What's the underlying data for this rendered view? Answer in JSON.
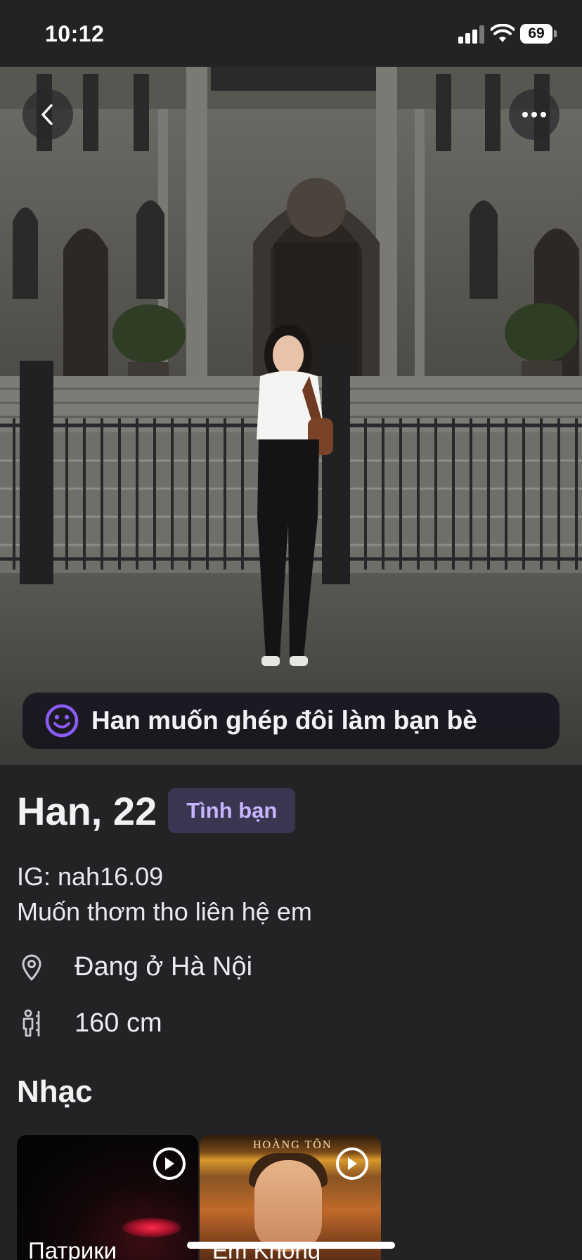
{
  "status_bar": {
    "time": "10:12",
    "battery": "69"
  },
  "photo": {
    "match_banner": "Han muốn ghép đôi làm bạn bè"
  },
  "profile": {
    "name_age": "Han, 22",
    "intent_badge": "Tình bạn",
    "bio_lines": [
      "IG: nah16.09",
      "Muốn thơm tho liên hệ em"
    ],
    "location": "Đang ở Hà Nội",
    "height": "160 cm"
  },
  "music": {
    "section_title": "Nhạc",
    "tracks": [
      {
        "title": "Патрики"
      },
      {
        "title": "Em Không",
        "album_text": "HOÀNG TÔN"
      }
    ]
  },
  "colors": {
    "accent_purple": "#8b5cf6",
    "badge_bg": "#3a3551",
    "badge_text": "#c7b5ff",
    "background": "#232326"
  },
  "icons": [
    "back-chevron-icon",
    "more-dots-icon",
    "smile-icon",
    "location-pin-icon",
    "height-icon",
    "play-icon"
  ]
}
